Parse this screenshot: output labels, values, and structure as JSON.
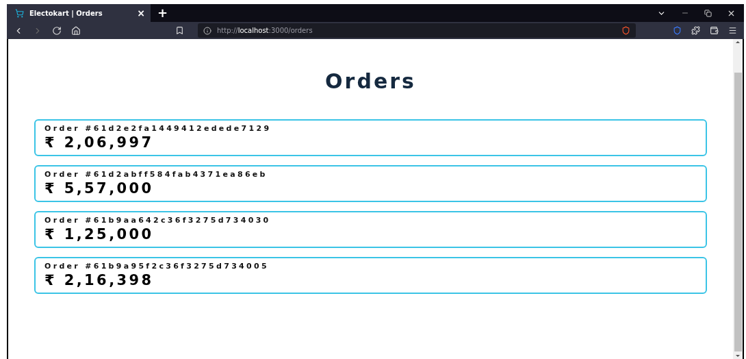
{
  "tab": {
    "title": "Electokart | Orders",
    "close": "×",
    "new_tab": "+"
  },
  "address": {
    "scheme": "http://",
    "host": "localhost",
    "rest": ":3000/orders"
  },
  "page": {
    "heading": "Orders",
    "orders": [
      {
        "label": "Order #61d2e2fa1449412edede7129",
        "amount": "₹ 2,06,997"
      },
      {
        "label": "Order #61d2abff584fab4371ea86eb",
        "amount": "₹ 5,57,000"
      },
      {
        "label": "Order #61b9aa642c36f3275d734030",
        "amount": "₹ 1,25,000"
      },
      {
        "label": "Order #61b9a95f2c36f3275d734005",
        "amount": "₹ 2,16,398"
      }
    ]
  }
}
